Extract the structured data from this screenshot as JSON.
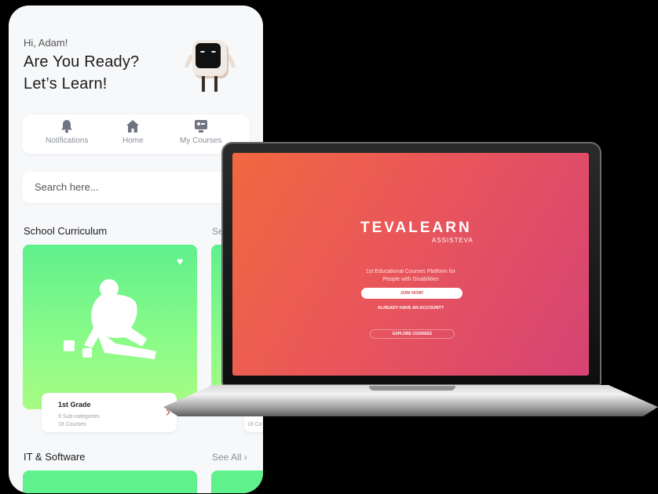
{
  "phone": {
    "greeting": "Hi, Adam!",
    "headline_line1": "Are You Ready?",
    "headline_line2": "Let’s Learn!",
    "nav": [
      {
        "label": "Notifications",
        "icon": "bell-icon"
      },
      {
        "label": "Home",
        "icon": "home-icon"
      },
      {
        "label": "My Courses",
        "icon": "courses-icon"
      }
    ],
    "search_placeholder": "Search here...",
    "sections": [
      {
        "title": "School Curriculum",
        "link": "Se"
      },
      {
        "title": "IT & Software",
        "link": "See All ›"
      }
    ],
    "cards": [
      {
        "title": "1st Grade",
        "subcategories": "9 Sub-categories",
        "courses": "18 Courses"
      },
      {
        "courses": "18 Co"
      }
    ]
  },
  "laptop": {
    "brand": "TEVALEARN",
    "brand_sub": "ASSISTEVA",
    "tagline_line1": "1st Educational Courses Platform for",
    "tagline_line2": "People with Disabilities",
    "join_button": "JOIN NOW!",
    "account_link": "ALREADY HAVE AN ACCOUNT?",
    "explore_button": "EXPLORE COURSES"
  },
  "colors": {
    "card_green": "#5ff08c",
    "screen_orange": "#f0683f",
    "screen_pink": "#d64374",
    "arrow": "#e0513a"
  }
}
